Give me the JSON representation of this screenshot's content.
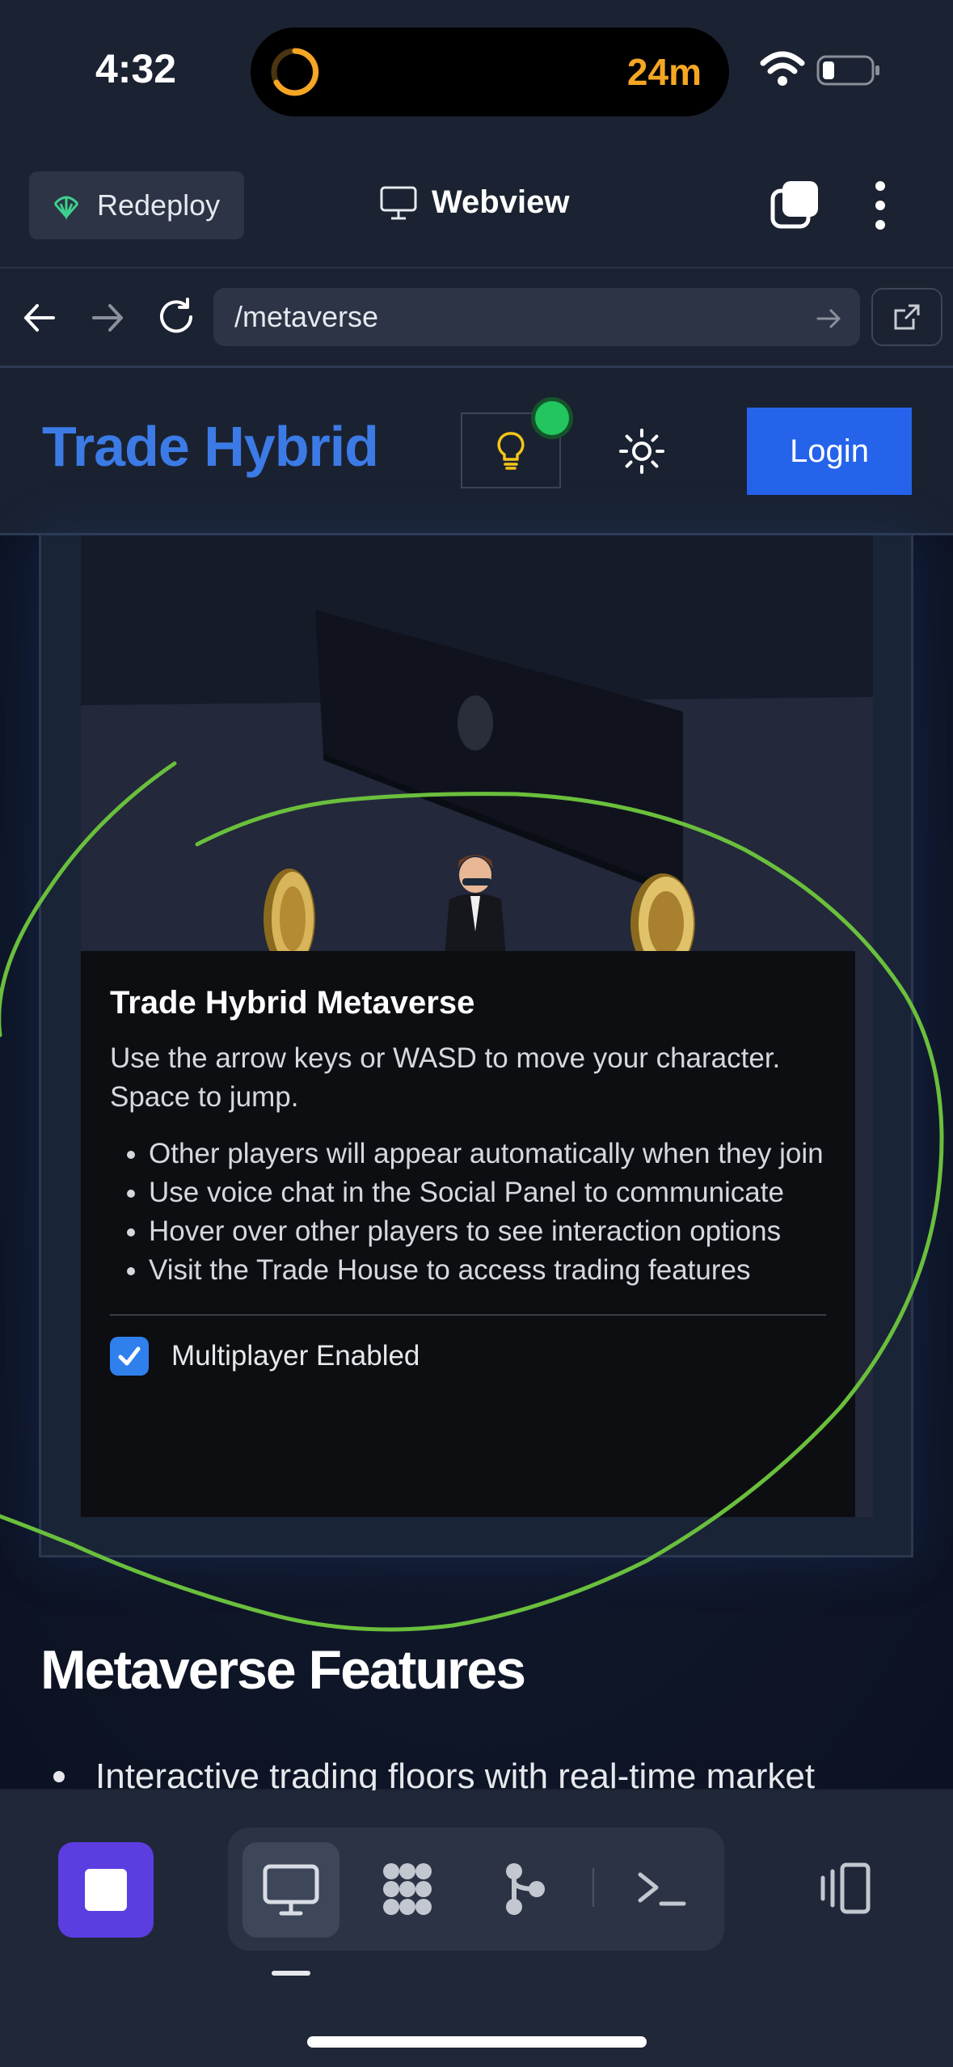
{
  "status_bar": {
    "time": "4:32",
    "timer": "24m"
  },
  "replit_bar": {
    "redeploy_label": "Redeploy",
    "title": "Webview"
  },
  "url_bar": {
    "url": "/metaverse"
  },
  "site_header": {
    "brand": "Trade Hybrid",
    "login_label": "Login",
    "status_color": "#22c55e",
    "brand_color": "#3c7be6",
    "button_color": "#2563eb"
  },
  "info_panel": {
    "title": "Trade Hybrid Metaverse",
    "description": "Use the arrow keys or WASD to move your character. Space to jump.",
    "tips": [
      "Other players will appear automatically when they join",
      "Use voice chat in the Social Panel to communicate",
      "Hover over other players to see interaction options",
      "Visit the Trade House to access trading features"
    ],
    "multiplayer_label": "Multiplayer Enabled",
    "multiplayer_checked": true
  },
  "features": {
    "heading": "Metaverse Features",
    "first_item": "Interactive trading floors with real-time market"
  },
  "bottom_bar": {
    "tools": [
      "webview-icon",
      "workflow-icon",
      "git-icon",
      "shell-icon"
    ],
    "accent": "#5b3de0"
  },
  "annotation_color": "#6abf3c"
}
